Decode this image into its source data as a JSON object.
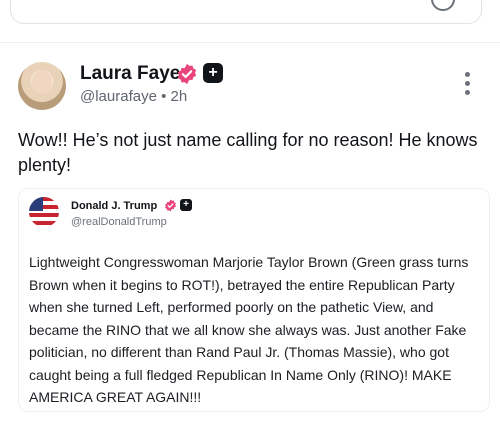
{
  "compose_box": {
    "icon": "circle-icon"
  },
  "post": {
    "author_name": "Laura Faye",
    "handle": "@laurafaye",
    "separator": "•",
    "time": "2h",
    "verified_icon": "verified-badge-icon",
    "plus_label": "+",
    "text": "Wow!! He’s not just name calling for no reason! He knows plenty!",
    "menu_icon": "more-vertical-icon"
  },
  "embedded_post": {
    "author_name": "Donald J. Trump",
    "handle": "@realDonaldTrump",
    "plus_label": "+",
    "text": "Lightweight Congresswoman Marjorie Taylor Brown (Green grass turns Brown when it begins to ROT!), betrayed the entire Republican Party when she turned Left, performed poorly on the pathetic View, and became the RINO that we all know she always was. Just another Fake politician, no different than Rand Paul Jr. (Thomas Massie), who got caught being a full fledged Republican In Name Only (RINO)! MAKE AMERICA GREAT AGAIN!!!"
  },
  "colors": {
    "verified": "#e8457a",
    "text": "#111418",
    "secondary": "#5f6670"
  }
}
